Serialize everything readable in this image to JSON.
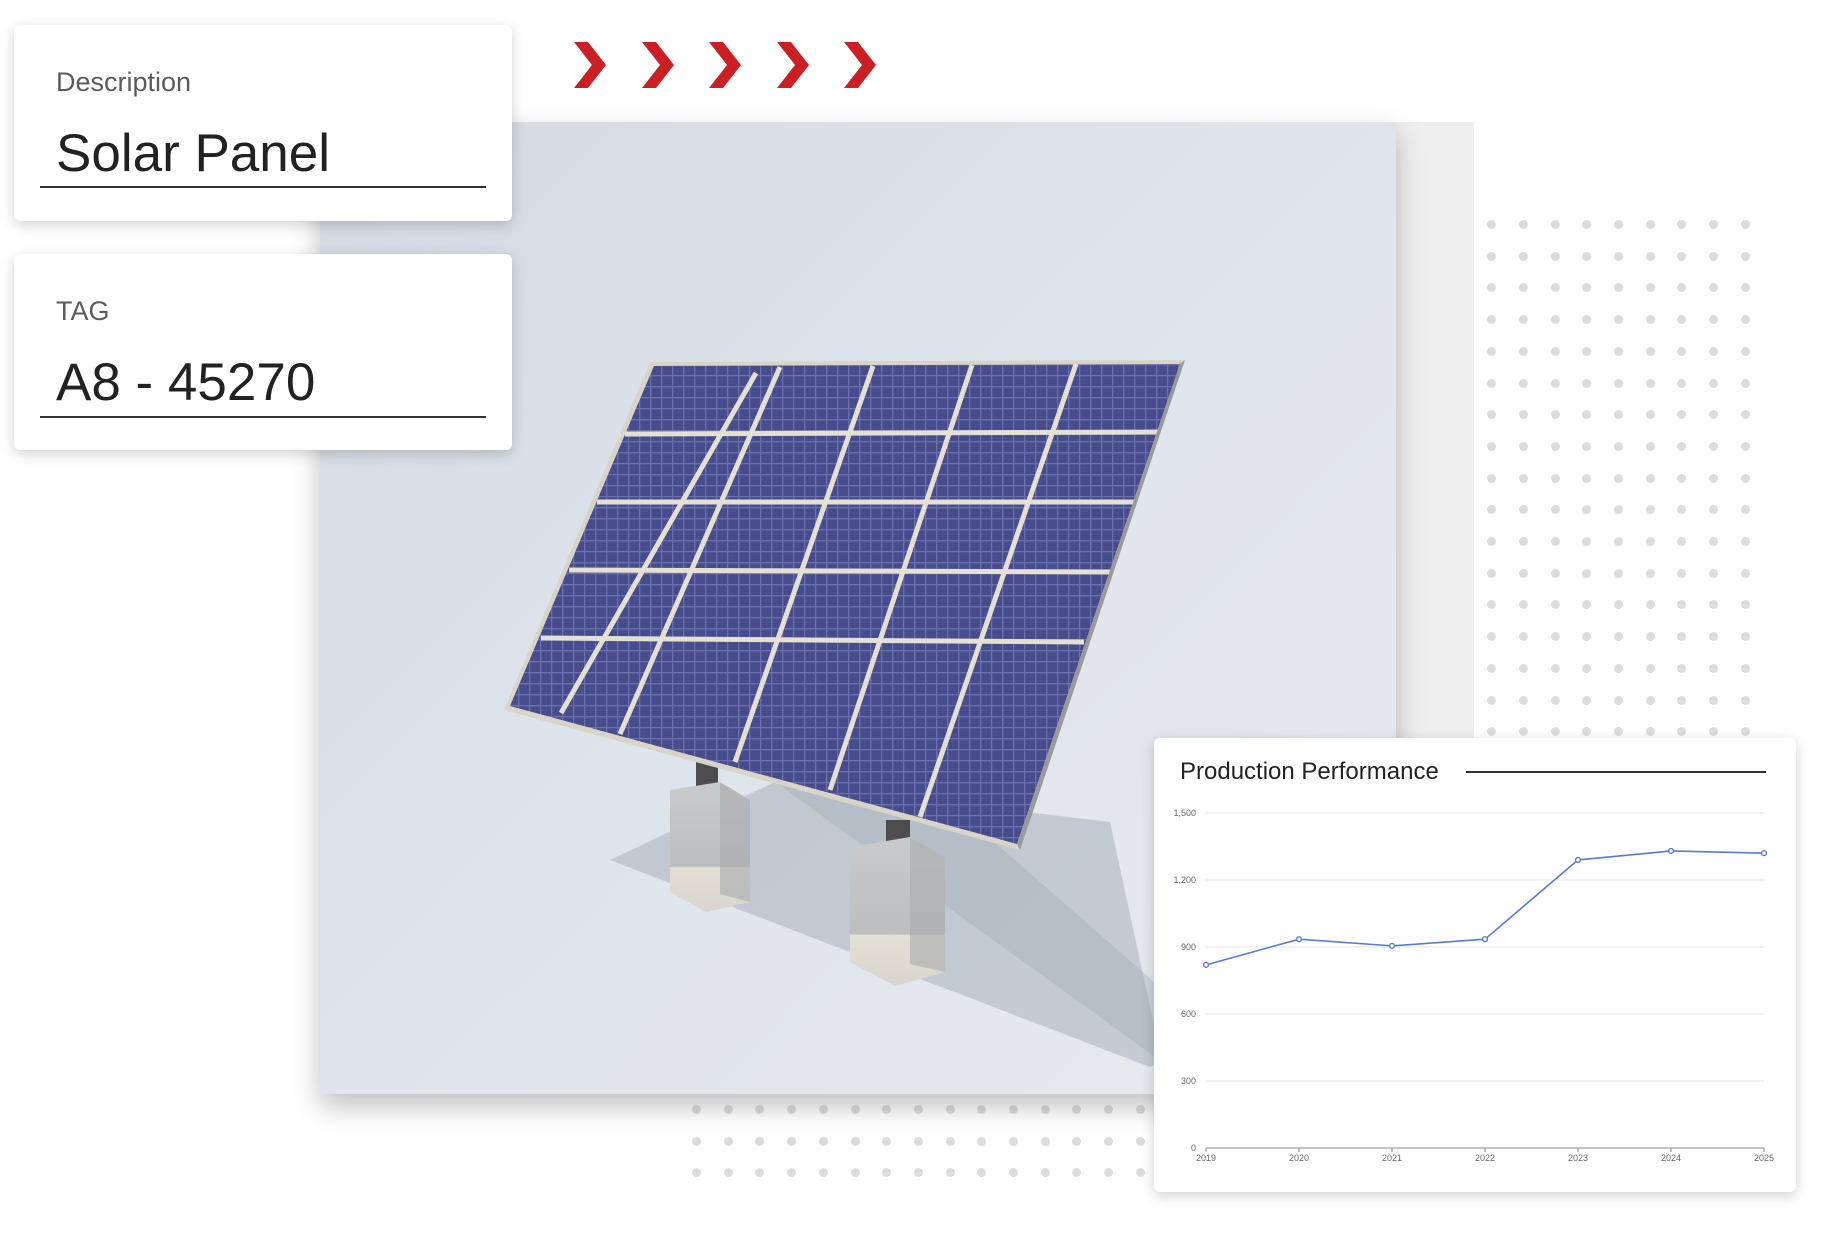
{
  "description_card": {
    "label": "Description",
    "value": "Solar Panel"
  },
  "tag_card": {
    "label": "TAG",
    "value": "A8 - 45270"
  },
  "progress_chevrons": {
    "count": 5,
    "color": "#cc1f24"
  },
  "colors": {
    "accent_red": "#cc1f24",
    "line_blue": "#5b7bd0",
    "panel_blue": "#4a4f8f"
  },
  "chart_data": {
    "type": "line",
    "title": "Production Performance",
    "x": [
      "2019",
      "2020",
      "2021",
      "2022",
      "2023",
      "2024",
      "2025"
    ],
    "series": [
      {
        "values": [
          820,
          935,
          905,
          935,
          1290,
          1330,
          1320
        ]
      }
    ],
    "ylim": [
      0,
      1500
    ],
    "yticks": [
      "0",
      "300",
      "600",
      "900",
      "1,200",
      "1,500"
    ],
    "grid": true,
    "xlabel": "",
    "ylabel": ""
  }
}
